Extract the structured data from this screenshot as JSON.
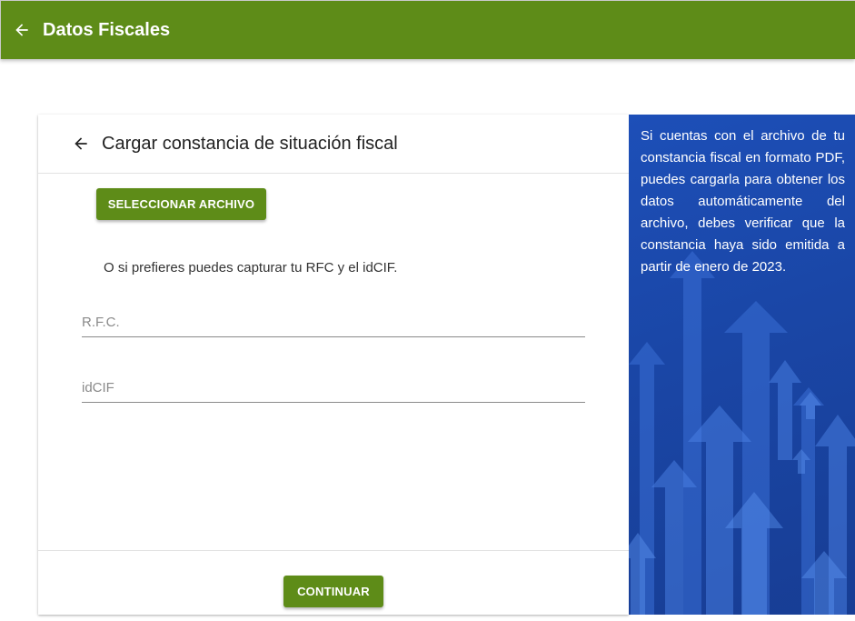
{
  "header": {
    "title": "Datos Fiscales",
    "back_icon": "arrow-left-icon",
    "color": "#5e8c18"
  },
  "card": {
    "heading": "Cargar constancia de situación fiscal",
    "back_icon": "arrow-left-icon",
    "select_button_label": "SELECCIONAR ARCHIVO",
    "hint_text": "O si prefieres puedes capturar tu RFC y el idCIF.",
    "rfc_field": {
      "placeholder": "R.F.C.",
      "value": ""
    },
    "idcif_field": {
      "placeholder": "idCIF",
      "value": ""
    },
    "continue_button_label": "CONTINUAR"
  },
  "info_panel": {
    "text": "Si cuentas con el archivo de tu constancia fiscal en formato PDF, puedes cargarla para obtener los datos automáticamente del archivo, debes verificar que la constancia haya sido emitida a partir de enero de 2023.",
    "background_color": "#1d4fb8",
    "background_icon": "rising-arrows-icon"
  }
}
